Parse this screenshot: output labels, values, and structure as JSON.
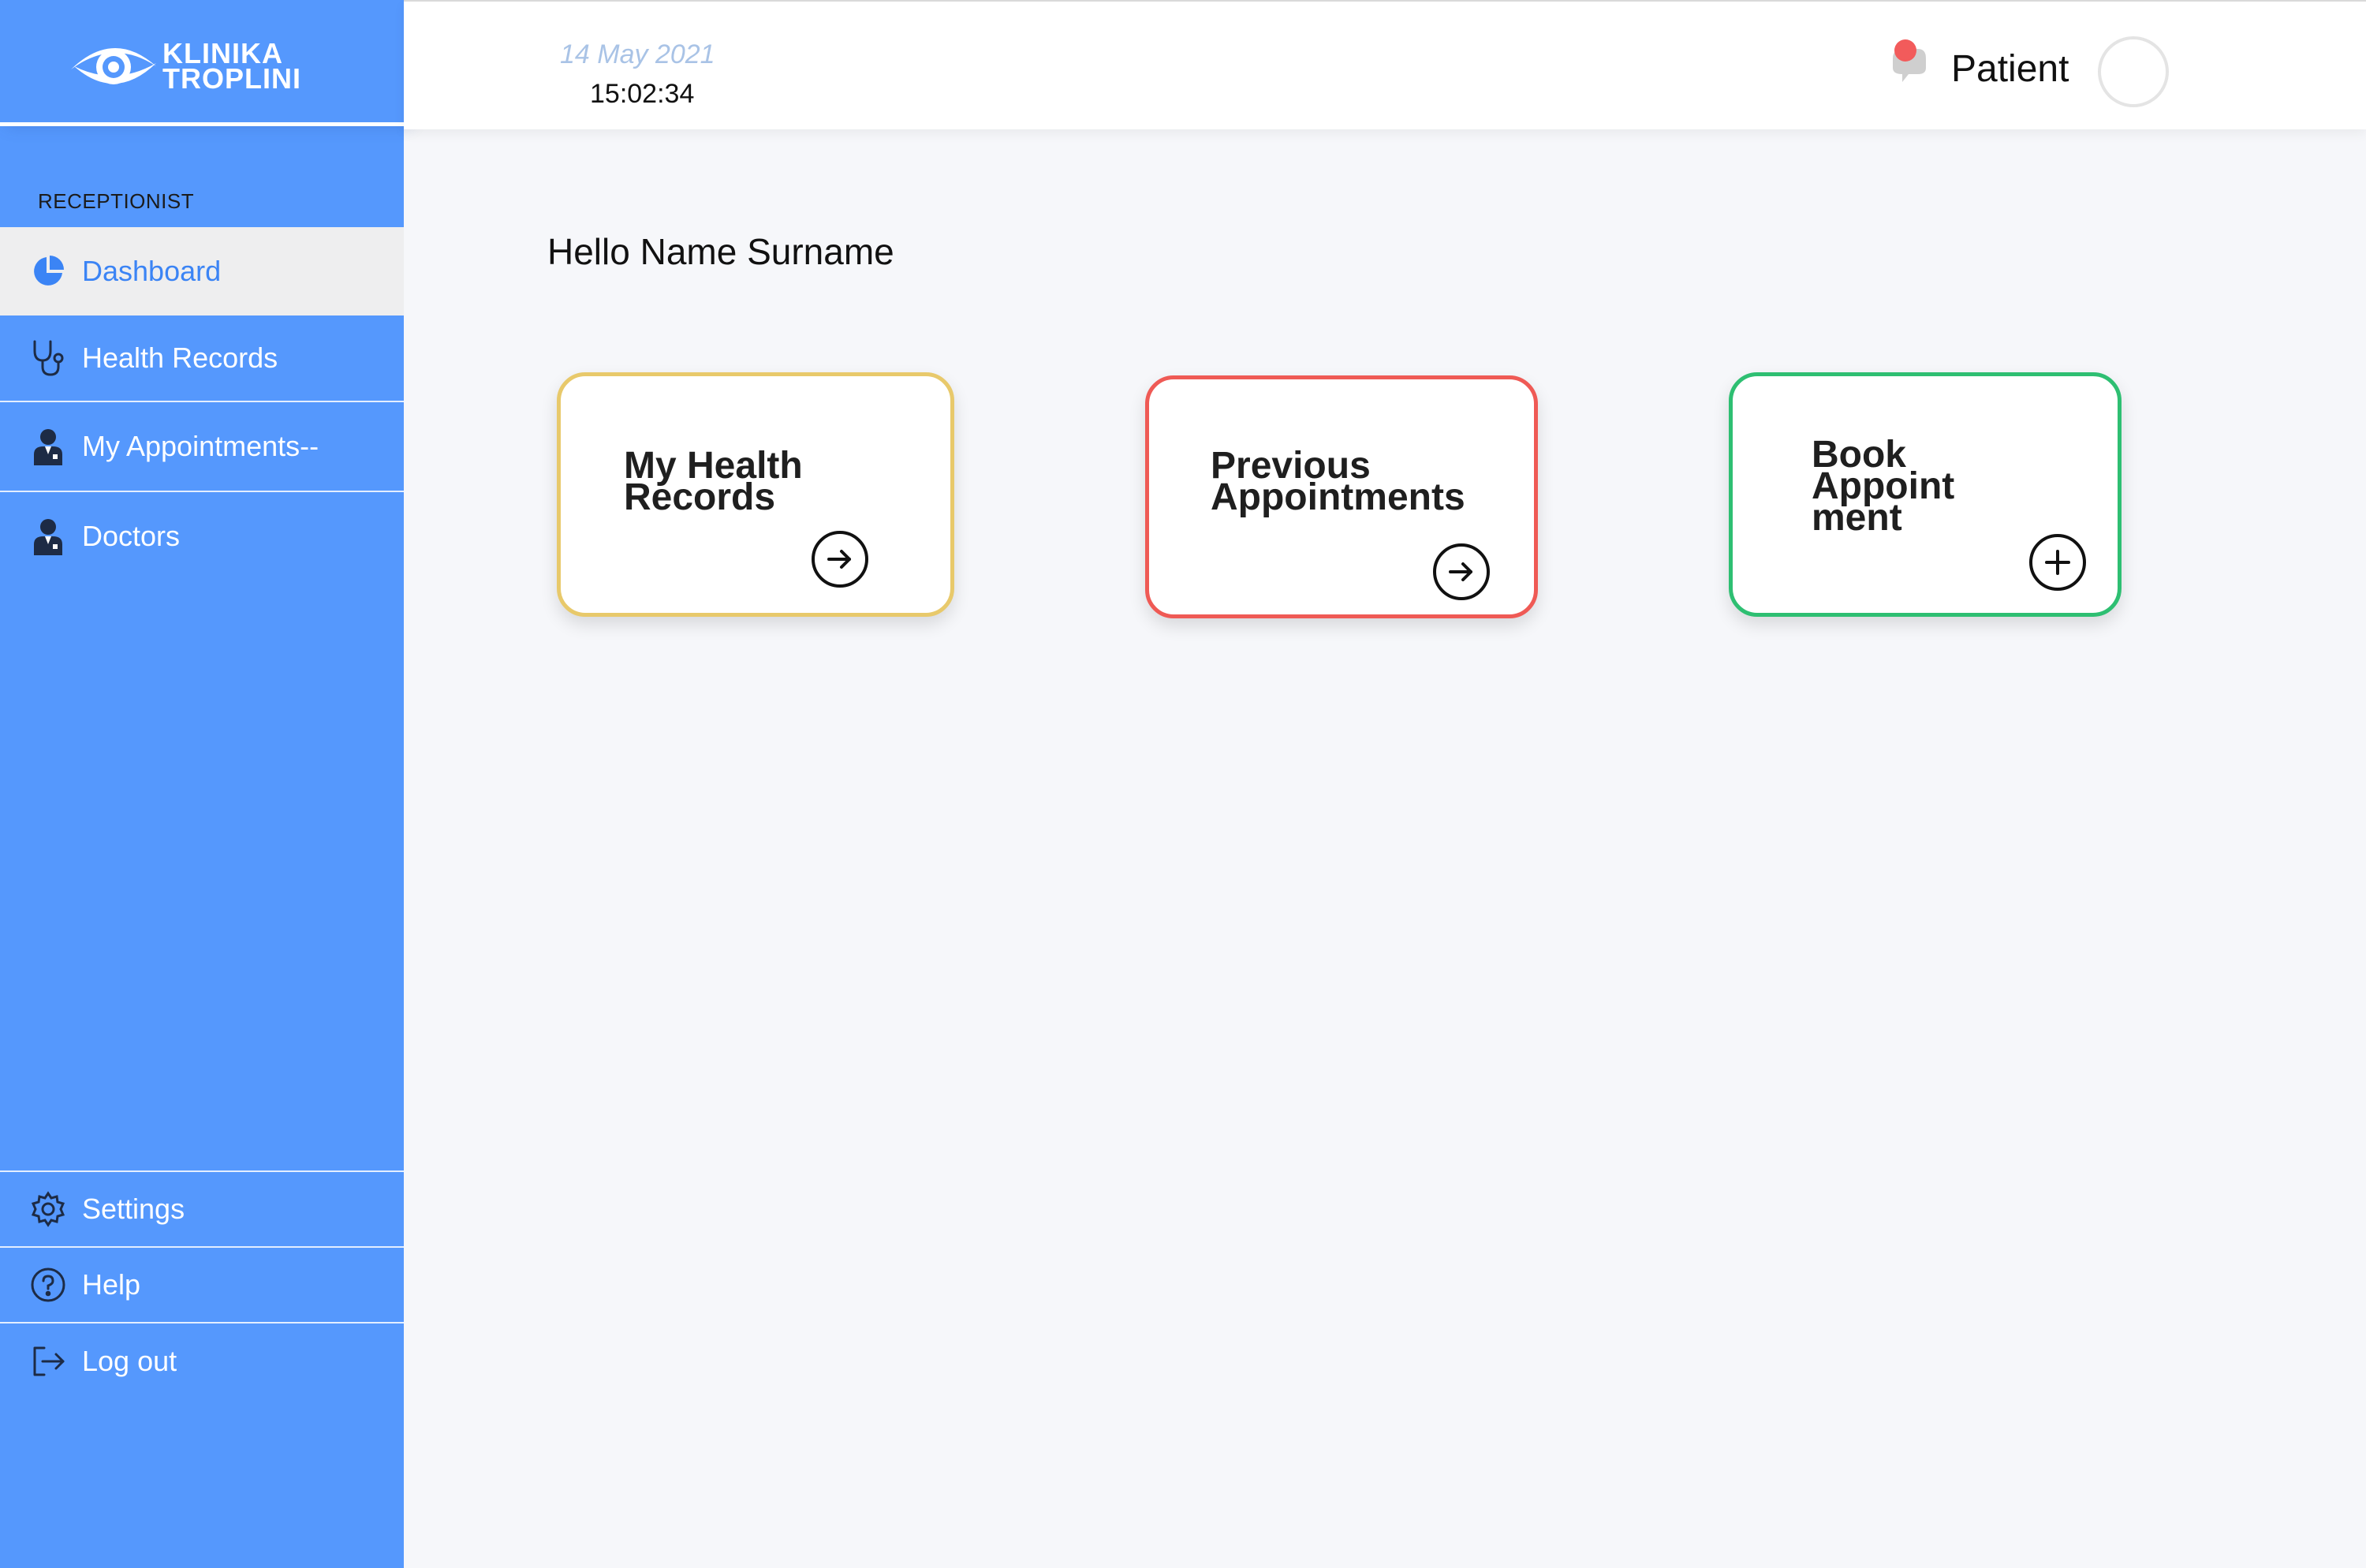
{
  "brand": {
    "line1": "KLINIKA",
    "line2": "TROPLINI"
  },
  "sidebar": {
    "role": "RECEPTIONIST",
    "items": [
      {
        "label": "Dashboard",
        "icon": "pie-chart-icon",
        "active": true
      },
      {
        "label": "Health Records",
        "icon": "stethoscope-icon"
      },
      {
        "label": "My Appointments--",
        "icon": "doctor-person-icon"
      },
      {
        "label": "Doctors",
        "icon": "doctor-person-icon"
      }
    ],
    "bottom_items": [
      {
        "label": "Settings",
        "icon": "gear-icon"
      },
      {
        "label": "Help",
        "icon": "help-circle-icon"
      },
      {
        "label": "Log out",
        "icon": "logout-icon"
      }
    ]
  },
  "header": {
    "date": "14 May 2021",
    "time": "15:02:34",
    "user_role": "Patient",
    "notification_icon": "chat-bubble-icon"
  },
  "main": {
    "greeting": "Hello Name Surname",
    "cards": [
      {
        "title": "My Health\nRecords",
        "action_icon": "arrow-right-icon",
        "border_color": "#e8c96b"
      },
      {
        "title": "Previous\nAppointments",
        "action_icon": "arrow-right-icon",
        "border_color": "#ef5a55"
      },
      {
        "title": "Book\nAppoint\nment",
        "action_icon": "plus-icon",
        "border_color": "#2ebf72"
      }
    ]
  },
  "colors": {
    "sidebar": "#5598fd",
    "active_text": "#3b84f5",
    "background": "#f6f7fa"
  }
}
